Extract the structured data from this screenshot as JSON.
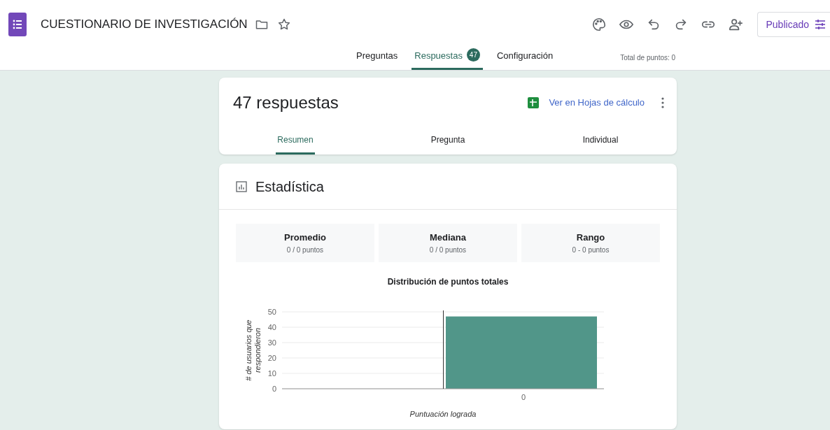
{
  "header": {
    "title": "CUESTIONARIO DE INVESTIGACIÓN",
    "publish_button": "Publicado"
  },
  "tabs": [
    {
      "label": "Preguntas",
      "selected": false
    },
    {
      "label": "Respuestas",
      "badge": "47",
      "selected": true
    },
    {
      "label": "Configuración",
      "selected": false
    }
  ],
  "total_points": "Total de puntos: 0",
  "responses": {
    "title": "47 respuestas",
    "sheets_link": "Ver en Hojas de cálculo",
    "tabs": [
      {
        "label": "Resumen",
        "selected": true
      },
      {
        "label": "Pregunta",
        "selected": false
      },
      {
        "label": "Individual",
        "selected": false
      }
    ]
  },
  "statistics": {
    "title": "Estadística",
    "stats": [
      {
        "label": "Promedio",
        "value": "0 / 0 puntos"
      },
      {
        "label": "Mediana",
        "value": "0 / 0 puntos"
      },
      {
        "label": "Rango",
        "value": "0 - 0 puntos"
      }
    ],
    "chart_data": {
      "type": "bar",
      "title": "Distribución de puntos totales",
      "xlabel": "Puntuación lograda",
      "ylabel": "# de usuarios que respondieron",
      "categories": [
        "0"
      ],
      "series": [
        {
          "color": "#519689",
          "values": [
            47
          ]
        }
      ],
      "grid": true,
      "ylim": [
        0,
        50
      ],
      "yticks": [
        0,
        10,
        20,
        30,
        40,
        50
      ]
    }
  }
}
